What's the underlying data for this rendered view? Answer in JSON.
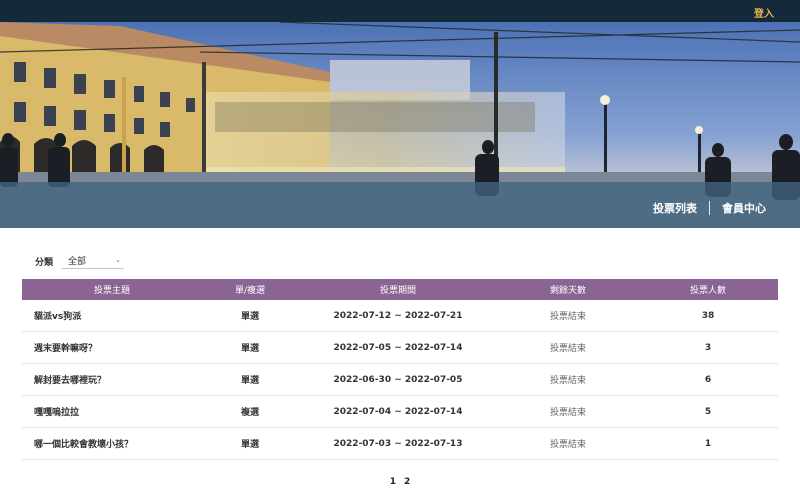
{
  "header": {
    "login_label": "登入"
  },
  "hero": {
    "nav": [
      {
        "label": "投票列表"
      },
      {
        "label": "會員中心"
      }
    ]
  },
  "filter": {
    "label": "分類",
    "selected": "全部"
  },
  "table": {
    "headers": [
      "投票主題",
      "單/複選",
      "投票期間",
      "剩餘天數",
      "投票人數"
    ],
    "rows": [
      {
        "title": "貓派vs狗派",
        "type": "單選",
        "period": "2022-07-12 ~ 2022-07-21",
        "remaining": "投票結束",
        "votes": "38"
      },
      {
        "title": "週末要幹嘛呀？",
        "type": "單選",
        "period": "2022-07-05 ~ 2022-07-14",
        "remaining": "投票結束",
        "votes": "3"
      },
      {
        "title": "解封要去哪裡玩？",
        "type": "單選",
        "period": "2022-06-30 ~ 2022-07-05",
        "remaining": "投票結束",
        "votes": "6"
      },
      {
        "title": "嘎嘎嗚拉拉",
        "type": "複選",
        "period": "2022-07-04 ~ 2022-07-14",
        "remaining": "投票結束",
        "votes": "5"
      },
      {
        "title": "哪一個比較會教壞小孩？",
        "type": "單選",
        "period": "2022-07-03 ~ 2022-07-13",
        "remaining": "投票結束",
        "votes": "1"
      }
    ]
  },
  "pagination": {
    "pages": [
      "1",
      "2"
    ]
  },
  "colors": {
    "topbar": "#142a3a",
    "login": "#e8b24a",
    "table_header": "#8a6593"
  }
}
